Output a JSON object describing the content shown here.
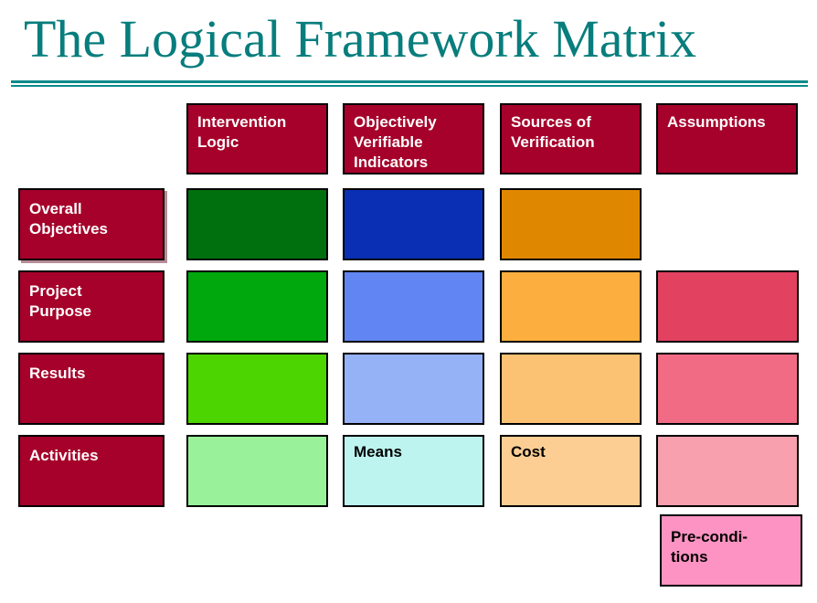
{
  "title": "The Logical Framework Matrix",
  "colors": {
    "title_text": "#087d7d",
    "title_rule": "#0b8a8a",
    "header_fill": "#A6012A",
    "row_header_fill": "#A6012A",
    "border": "#000000"
  },
  "column_headers": [
    {
      "id": "intervention-logic",
      "label": "Intervention Logic",
      "lines": [
        "Intervention",
        "Logic"
      ]
    },
    {
      "id": "objectively-verifiable-indicators",
      "label": "Objectively Verifiable Indicators",
      "lines": [
        "Objectively",
        "Verifiable",
        "Indicators"
      ]
    },
    {
      "id": "sources-of-verification",
      "label": "Sources of Verification",
      "lines": [
        "Sources of",
        "Verification"
      ]
    },
    {
      "id": "assumptions",
      "label": "Assumptions",
      "lines": [
        "Assumptions"
      ]
    }
  ],
  "row_headers": [
    {
      "id": "overall-objectives",
      "label": "Overall Objectives",
      "lines": [
        "Overall",
        "Objectives"
      ]
    },
    {
      "id": "project-purpose",
      "label": "Project Purpose",
      "lines": [
        "Project",
        "Purpose"
      ]
    },
    {
      "id": "results",
      "label": "Results",
      "lines": [
        "Results"
      ]
    },
    {
      "id": "activities",
      "label": "Activities",
      "lines": [
        "Activities"
      ]
    }
  ],
  "grid": [
    {
      "row": "overall-objectives",
      "cells": [
        {
          "column": "intervention-logic",
          "text": "",
          "fill": "#00700F",
          "present": true
        },
        {
          "column": "objectively-verifiable-indicators",
          "text": "",
          "fill": "#0A2FB5",
          "present": true
        },
        {
          "column": "sources-of-verification",
          "text": "",
          "fill": "#E08700",
          "present": true
        },
        {
          "column": "assumptions",
          "text": "",
          "fill": "",
          "present": false
        }
      ]
    },
    {
      "row": "project-purpose",
      "cells": [
        {
          "column": "intervention-logic",
          "text": "",
          "fill": "#00A80E",
          "present": true
        },
        {
          "column": "objectively-verifiable-indicators",
          "text": "",
          "fill": "#6185F2",
          "present": true
        },
        {
          "column": "sources-of-verification",
          "text": "",
          "fill": "#FCAE3E",
          "present": true
        },
        {
          "column": "assumptions",
          "text": "",
          "fill": "#E24260",
          "present": true
        }
      ]
    },
    {
      "row": "results",
      "cells": [
        {
          "column": "intervention-logic",
          "text": "",
          "fill": "#4CD500",
          "present": true
        },
        {
          "column": "objectively-verifiable-indicators",
          "text": "",
          "fill": "#96B2F7",
          "present": true
        },
        {
          "column": "sources-of-verification",
          "text": "",
          "fill": "#FCC274",
          "present": true
        },
        {
          "column": "assumptions",
          "text": "",
          "fill": "#F26B84",
          "present": true
        }
      ]
    },
    {
      "row": "activities",
      "cells": [
        {
          "column": "intervention-logic",
          "text": "",
          "fill": "#99F299",
          "present": true
        },
        {
          "column": "objectively-verifiable-indicators",
          "text": "Means",
          "fill": "#BDF4F0",
          "present": true
        },
        {
          "column": "sources-of-verification",
          "text": "Cost",
          "fill": "#FCCE94",
          "present": true
        },
        {
          "column": "assumptions",
          "text": "",
          "fill": "#F9A0AF",
          "present": true
        }
      ]
    }
  ],
  "preconditions": {
    "id": "pre-conditions",
    "label": "Pre-conditions",
    "lines": [
      "Pre-condi-",
      "tions"
    ],
    "fill": "#FC93C2"
  }
}
